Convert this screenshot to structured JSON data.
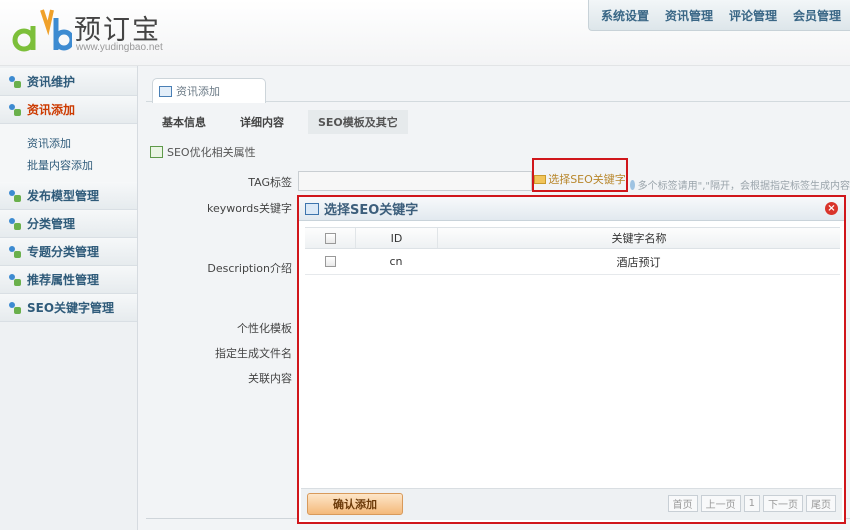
{
  "header": {
    "logo_text": "预订宝",
    "logo_url": "www.yudingbao.net",
    "nav": [
      "系统设置",
      "资讯管理",
      "评论管理",
      "会员管理"
    ]
  },
  "sidebar": {
    "items": [
      {
        "label": "资讯维护"
      },
      {
        "label": "资讯添加"
      },
      {
        "label": "发布模型管理"
      },
      {
        "label": "分类管理"
      },
      {
        "label": "专题分类管理"
      },
      {
        "label": "推荐属性管理"
      },
      {
        "label": "SEO关键字管理"
      }
    ],
    "subitems": [
      "资讯添加",
      "批量内容添加"
    ]
  },
  "main": {
    "tab": "资讯添加",
    "subtabs": [
      "基本信息",
      "详细内容",
      "SEO模板及其它"
    ],
    "section_title": "SEO优化相关属性",
    "labels": {
      "tag": "TAG标签",
      "keywords": "keywords关键字",
      "description": "Description介绍",
      "template": "个性化模板",
      "filename": "指定生成文件名",
      "related": "关联内容"
    },
    "seo_button": "选择SEO关键字",
    "hint": "多个标签请用\",\"隔开，会根据指定标签生成内容"
  },
  "dialog": {
    "title": "选择SEO关键字",
    "columns": [
      "",
      "ID",
      "关键字名称"
    ],
    "rows": [
      {
        "id": "cn",
        "name": "酒店预订"
      }
    ],
    "confirm": "确认添加",
    "pager": [
      "首页",
      "上一页",
      "1",
      "下一页",
      "尾页"
    ]
  },
  "colors": {
    "highlight_border": "#d0161b",
    "nav_text": "#3a6786",
    "active_side": "#cc3a00"
  }
}
